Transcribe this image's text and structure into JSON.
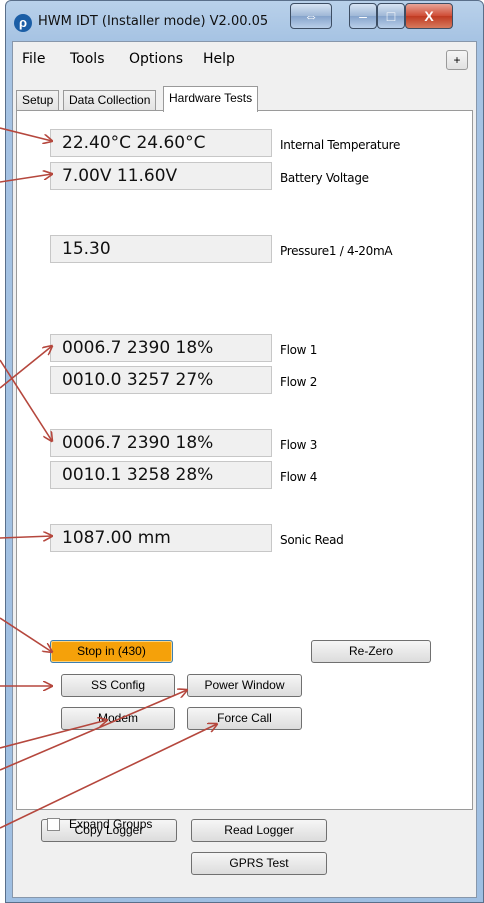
{
  "window": {
    "title": "HWM IDT (Installer mode) V2.00.05",
    "app_icon_glyph": "ρ",
    "controls": {
      "resize_glyph": "⇔",
      "minimize_glyph": "–",
      "maximize_glyph": "□",
      "close_glyph": "X"
    },
    "accent_color": "#f5a10a"
  },
  "menu": {
    "items": [
      {
        "label": "File"
      },
      {
        "label": "Tools"
      },
      {
        "label": "Options"
      },
      {
        "label": "Help"
      }
    ],
    "plus_label": "+"
  },
  "tabs": [
    {
      "label": "Setup",
      "active": false
    },
    {
      "label": "Data Collection",
      "active": false
    },
    {
      "label": "Hardware Tests",
      "active": true
    }
  ],
  "readings": {
    "temperature": {
      "value": "22.40°C 24.60°C",
      "label": "Internal Temperature"
    },
    "battery": {
      "value": "7.00V  11.60V",
      "label": "Battery Voltage"
    },
    "pressure": {
      "value": "15.30",
      "label": "Pressure1 / 4-20mA"
    },
    "flow1": {
      "value": "0006.7  2390  18%",
      "label": "Flow 1"
    },
    "flow2": {
      "value": "0010.0  3257  27%",
      "label": "Flow 2"
    },
    "flow3": {
      "value": "0006.7  2390  18%",
      "label": "Flow 3"
    },
    "flow4": {
      "value": "0010.1  3258  28%",
      "label": "Flow 4"
    },
    "sonic": {
      "value": "1087.00 mm",
      "label": "Sonic Read"
    }
  },
  "buttons": {
    "stop": "Stop in (430)",
    "rezero": "Re-Zero",
    "ss_config": "SS Config",
    "power_window": "Power Window",
    "modem": "Modem",
    "force_call": "Force Call",
    "copy_logger": "Copy Logger",
    "read_logger": "Read Logger",
    "gprs_test": "GPRS Test"
  },
  "expand_groups": {
    "label": "Expand Groups",
    "checked": false
  }
}
